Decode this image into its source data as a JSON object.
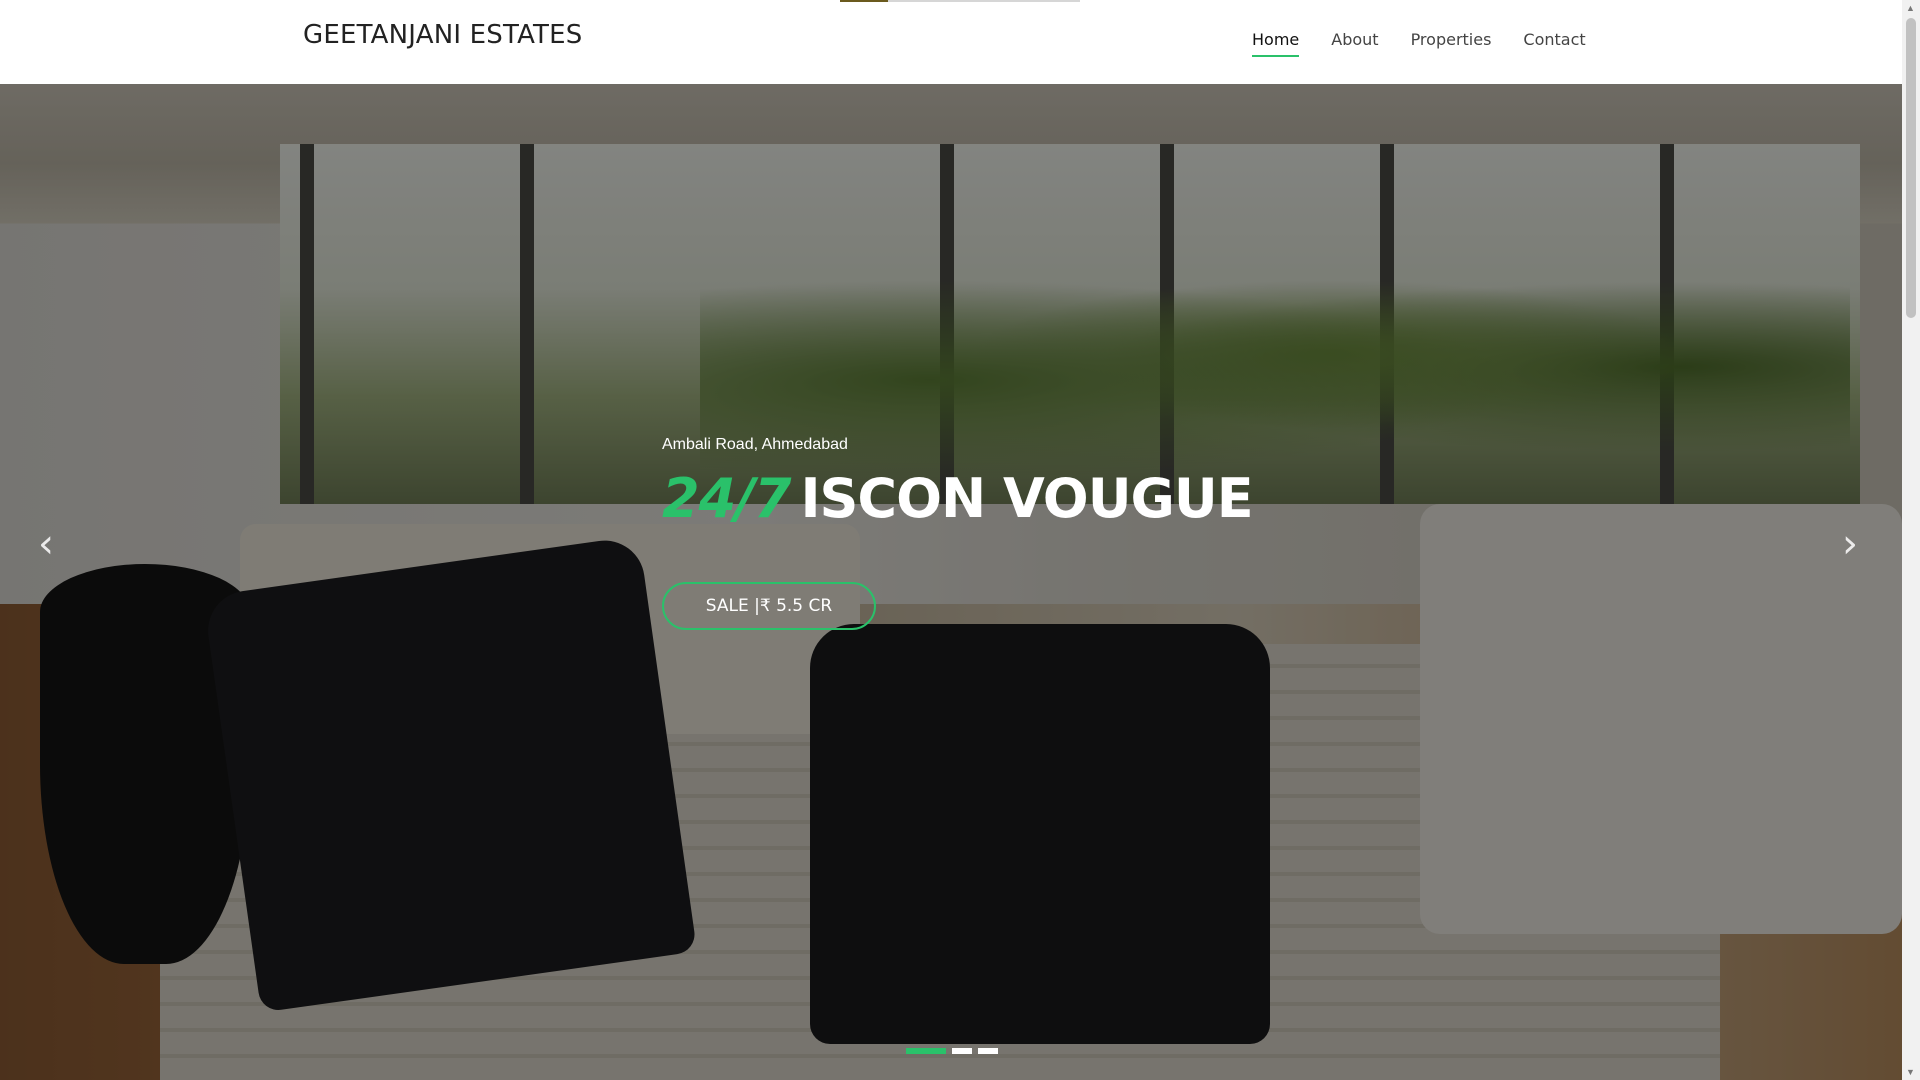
{
  "header": {
    "brand": "GEETANJANI ESTATES",
    "nav": [
      {
        "label": "Home",
        "active": true
      },
      {
        "label": "About",
        "active": false
      },
      {
        "label": "Properties",
        "active": false
      },
      {
        "label": "Contact",
        "active": false
      }
    ]
  },
  "hero": {
    "location": "Ambali Road, Ahmedabad",
    "headline_accent": "24/7",
    "headline_name": "ISCON VOUGUE",
    "cta_label": "SALE |₹ 5.5 CR",
    "prev_icon": "chevron-left-icon",
    "next_icon": "chevron-right-icon",
    "slides_total": 3,
    "active_slide": 1
  },
  "colors": {
    "accent": "#2ac16a",
    "text_dark": "#222222",
    "overlay": "rgba(0,0,0,0.45)"
  }
}
